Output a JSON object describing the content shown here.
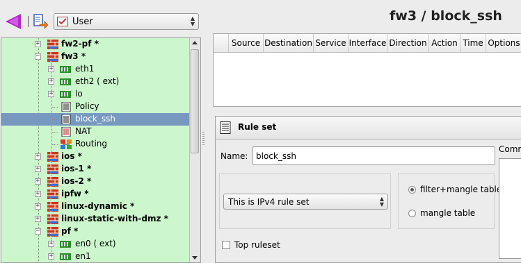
{
  "toolbar": {
    "library_select": {
      "value": "User"
    }
  },
  "tree": {
    "items": [
      {
        "label": "fw2-pf *",
        "kind": "firewall",
        "bold": true,
        "expanded": false
      },
      {
        "label": "fw3 *",
        "kind": "firewall",
        "bold": true,
        "expanded": true
      },
      {
        "label": "eth1",
        "kind": "interface"
      },
      {
        "label": "eth2 ( ext)",
        "kind": "interface"
      },
      {
        "label": "lo",
        "kind": "interface"
      },
      {
        "label": "Policy",
        "kind": "policy"
      },
      {
        "label": "block_ssh",
        "kind": "policy",
        "selected": true
      },
      {
        "label": "NAT",
        "kind": "nat"
      },
      {
        "label": "Routing",
        "kind": "routing"
      },
      {
        "label": "ios *",
        "kind": "firewall",
        "bold": true
      },
      {
        "label": "ios-1 *",
        "kind": "firewall",
        "bold": true
      },
      {
        "label": "ios-2 *",
        "kind": "firewall",
        "bold": true
      },
      {
        "label": "ipfw *",
        "kind": "firewall",
        "bold": true
      },
      {
        "label": "linux-dynamic *",
        "kind": "firewall",
        "bold": true
      },
      {
        "label": "linux-static-with-dmz *",
        "kind": "firewall",
        "bold": true
      },
      {
        "label": "pf *",
        "kind": "firewall",
        "bold": true,
        "expanded": true
      },
      {
        "label": "en0 ( ext)",
        "kind": "interface"
      },
      {
        "label": "en1",
        "kind": "interface"
      }
    ]
  },
  "header": {
    "title": "fw3 / block_ssh"
  },
  "rules_table": {
    "columns": [
      "Source",
      "Destination",
      "Service",
      "Interface",
      "Direction",
      "Action",
      "Time",
      "Options"
    ]
  },
  "editor": {
    "section_title": "Rule set",
    "name_label": "Name:",
    "name_value": "block_ssh",
    "ip_version_select": "This is IPv4 rule set",
    "radio_filter_mangle": "filter+mangle table",
    "radio_mangle": "mangle table",
    "top_ruleset_label": "Top ruleset",
    "comment_label": "Comm"
  },
  "colors": {
    "tree_background": "#ccf7cc",
    "tree_selection": "#7799c0",
    "back_arrow": "#b02cc8"
  }
}
